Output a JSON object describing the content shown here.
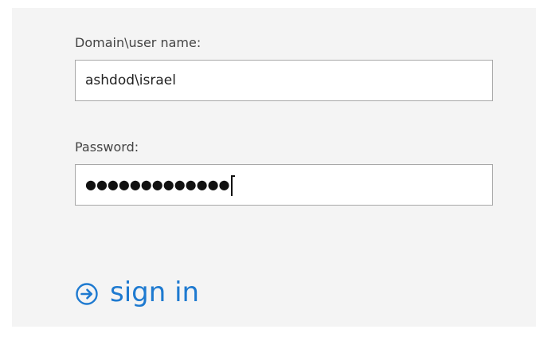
{
  "form": {
    "username": {
      "label": "Domain\\user name:",
      "value": "ashdod\\israel"
    },
    "password": {
      "label": "Password:",
      "masked_value": "●●●●●●●●●●●●●"
    },
    "sign_in": {
      "label": "sign in",
      "icon": "circle-arrow-right-icon"
    }
  },
  "colors": {
    "accent": "#1e7ad0",
    "panel_background": "#f4f4f4",
    "input_border": "#a8a8a8",
    "label_text": "#444444"
  }
}
